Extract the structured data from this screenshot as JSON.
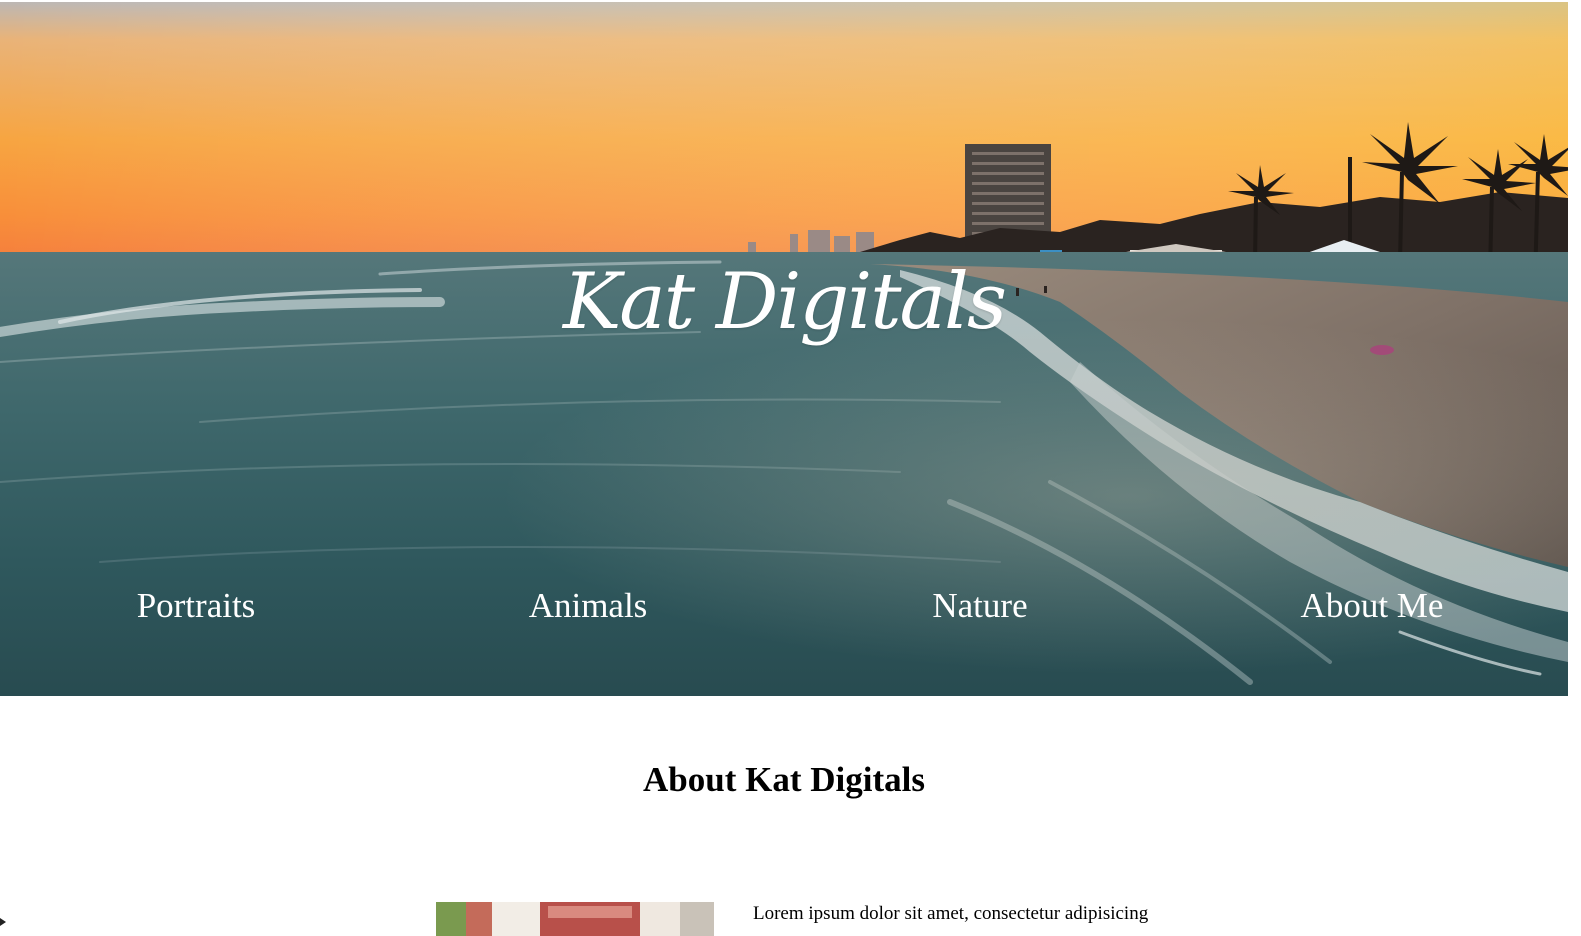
{
  "hero": {
    "site_title": "Kat Digitals"
  },
  "nav": {
    "items": [
      {
        "label": "Portraits"
      },
      {
        "label": "Animals"
      },
      {
        "label": "Nature"
      },
      {
        "label": "About Me"
      }
    ]
  },
  "about": {
    "heading": "About Kat Digitals",
    "body_text": "Lorem ipsum dolor sit amet, consectetur adipisicing"
  }
}
